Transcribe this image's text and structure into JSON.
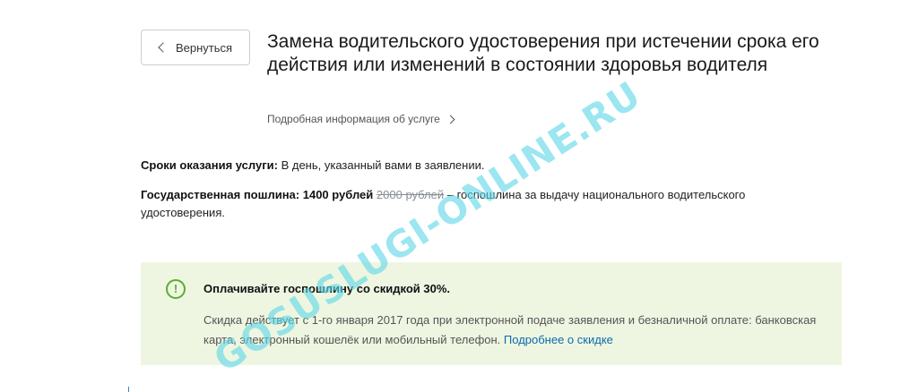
{
  "back_button": {
    "label": "Вернуться"
  },
  "service": {
    "title": "Замена водительского удостоверения при истечении срока его действия или изменений в состоянии здоровья водителя",
    "details_link": "Подробная информация об услуге"
  },
  "info": {
    "terms_label": "Сроки оказания услуги:",
    "terms_value": " В день, указанный вами в заявлении.",
    "fee_label": "Государственная пошлина: 1400 рублей",
    "fee_old": "2000 рублей",
    "fee_note": " – госпошлина за выдачу национального водительского удостоверения."
  },
  "discount": {
    "icon": "exclamation-circle-icon",
    "title": "Оплачивайте госпошлину со скидкой 30%.",
    "text": "Скидка действует с 1-го января 2017 года при электронной подаче заявления и безналичной оплате: банковская карта, электронный кошелёк или мобильный телефон. ",
    "link": "Подробнее о скидке",
    "accent_color": "#5aaf2d",
    "background_color": "#eef6e2"
  },
  "watermark": {
    "text": "GOSUSLUGI-ONLINE.RU"
  }
}
